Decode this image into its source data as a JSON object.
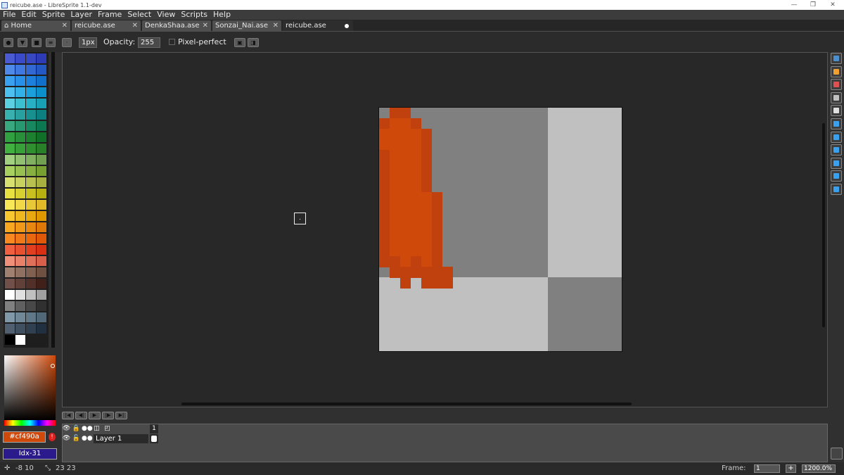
{
  "window": {
    "title": "reicube.ase - LibreSprite 1.1-dev",
    "minimize": "—",
    "maximize": "❐",
    "close": "✕"
  },
  "menu": [
    "File",
    "Edit",
    "Sprite",
    "Layer",
    "Frame",
    "Select",
    "View",
    "Scripts",
    "Help"
  ],
  "tabs": [
    {
      "label": "Home",
      "close": "✕"
    },
    {
      "label": "reicube.ase",
      "close": "✕"
    },
    {
      "label": "DenkaShaa.ase",
      "close": "✕"
    },
    {
      "label": "Sonzai_Nai.ase",
      "close": "✕"
    },
    {
      "label": "reicube.ase",
      "modified": true
    }
  ],
  "context": {
    "brush_size": "1px",
    "opacity_label": "Opacity:",
    "opacity_value": "255",
    "pixel_perfect_label": "Pixel-perfect",
    "pixel_perfect_checked": false
  },
  "palette": [
    [
      "#4a5ad0",
      "#3a4ac8",
      "#3848c0",
      "#2d3cb6"
    ],
    [
      "#4f8ae8",
      "#3e78e0",
      "#3268d2",
      "#2458c4"
    ],
    [
      "#3aa0f0",
      "#2890e8",
      "#1c80dc",
      "#1070cc"
    ],
    [
      "#4ec0f0",
      "#32b0e8",
      "#1ca0dc",
      "#0c90cc"
    ],
    [
      "#5ad0e0",
      "#3cc0d0",
      "#28b0c4",
      "#18a0b4"
    ],
    [
      "#38b0b0",
      "#28a0a0",
      "#189090",
      "#0c8080"
    ],
    [
      "#38a880",
      "#289870",
      "#188860",
      "#0c7850"
    ],
    [
      "#30a040",
      "#289038",
      "#1c8030",
      "#107028"
    ],
    [
      "#40b040",
      "#38a038",
      "#309030",
      "#288028"
    ],
    [
      "#a0d080",
      "#90c070",
      "#80b060",
      "#70a050"
    ],
    [
      "#a8d060",
      "#98c050",
      "#88b040",
      "#78a030"
    ],
    [
      "#d8e070",
      "#c8d060",
      "#b8c050",
      "#a8b040"
    ],
    [
      "#e8e040",
      "#d8d030",
      "#c8c020",
      "#b8b010"
    ],
    [
      "#f8e858",
      "#f0d848",
      "#e8c838",
      "#e0b828"
    ],
    [
      "#f8c830",
      "#f0b820",
      "#e8a810",
      "#e09800"
    ],
    [
      "#f8a820",
      "#f09818",
      "#e88810",
      "#e07808"
    ],
    [
      "#f88820",
      "#f07818",
      "#e86810",
      "#e05808"
    ],
    [
      "#f06040",
      "#e85030",
      "#e04020",
      "#d83010"
    ],
    [
      "#f0907a",
      "#e8806a",
      "#e0705a",
      "#d8604a"
    ],
    [
      "#a08070",
      "#907060",
      "#806050",
      "#705040"
    ],
    [
      "#705048",
      "#604038",
      "#503028",
      "#402018"
    ],
    [
      "#ffffff",
      "#e0e0e0",
      "#c0c0c0",
      "#a0a0a0"
    ],
    [
      "#808080",
      "#606060",
      "#484848",
      "#303030"
    ],
    [
      "#8098a8",
      "#708898",
      "#607888",
      "#506878"
    ],
    [
      "#506070",
      "#405060",
      "#304050",
      "#203040"
    ],
    [
      "#000000",
      "#ffffff",
      "#1e1e1e",
      "#1e1e1e"
    ]
  ],
  "colors": {
    "foreground": "#cf490a",
    "foreground_label": "#cf490a",
    "background_label": "Idx-31"
  },
  "canvas": {
    "grid": 23,
    "light": "#c0c0c0",
    "dark": "#808080",
    "pixels": [
      [
        0,
        1,
        "#c0400e"
      ],
      [
        0,
        2,
        "#c0400e"
      ],
      [
        1,
        0,
        "#c0400e"
      ],
      [
        1,
        1,
        "#cf490a"
      ],
      [
        1,
        2,
        "#cf490a"
      ],
      [
        1,
        3,
        "#c0400e"
      ],
      [
        2,
        0,
        "#cf490a"
      ],
      [
        2,
        1,
        "#cf490a"
      ],
      [
        2,
        2,
        "#cf490a"
      ],
      [
        2,
        3,
        "#cf490a"
      ],
      [
        2,
        4,
        "#c0400e"
      ],
      [
        3,
        0,
        "#cf490a"
      ],
      [
        3,
        1,
        "#cf490a"
      ],
      [
        3,
        2,
        "#cf490a"
      ],
      [
        3,
        3,
        "#cf490a"
      ],
      [
        3,
        4,
        "#c0400e"
      ],
      [
        4,
        0,
        "#c0400e"
      ],
      [
        4,
        1,
        "#cf490a"
      ],
      [
        4,
        2,
        "#cf490a"
      ],
      [
        4,
        3,
        "#cf490a"
      ],
      [
        4,
        4,
        "#c0400e"
      ],
      [
        5,
        0,
        "#c0400e"
      ],
      [
        5,
        1,
        "#cf490a"
      ],
      [
        5,
        2,
        "#cf490a"
      ],
      [
        5,
        3,
        "#cf490a"
      ],
      [
        5,
        4,
        "#c0400e"
      ],
      [
        6,
        0,
        "#c0400e"
      ],
      [
        6,
        1,
        "#cf490a"
      ],
      [
        6,
        2,
        "#cf490a"
      ],
      [
        6,
        3,
        "#cf490a"
      ],
      [
        6,
        4,
        "#c0400e"
      ],
      [
        7,
        0,
        "#c0400e"
      ],
      [
        7,
        1,
        "#cf490a"
      ],
      [
        7,
        2,
        "#cf490a"
      ],
      [
        7,
        3,
        "#cf490a"
      ],
      [
        7,
        4,
        "#c0400e"
      ],
      [
        8,
        0,
        "#c0400e"
      ],
      [
        8,
        1,
        "#cf490a"
      ],
      [
        8,
        2,
        "#cf490a"
      ],
      [
        8,
        3,
        "#cf490a"
      ],
      [
        8,
        4,
        "#cf490a"
      ],
      [
        8,
        5,
        "#c0400e"
      ],
      [
        9,
        0,
        "#c0400e"
      ],
      [
        9,
        1,
        "#cf490a"
      ],
      [
        9,
        2,
        "#cf490a"
      ],
      [
        9,
        3,
        "#cf490a"
      ],
      [
        9,
        4,
        "#cf490a"
      ],
      [
        9,
        5,
        "#c0400e"
      ],
      [
        10,
        0,
        "#c0400e"
      ],
      [
        10,
        1,
        "#cf490a"
      ],
      [
        10,
        2,
        "#cf490a"
      ],
      [
        10,
        3,
        "#cf490a"
      ],
      [
        10,
        4,
        "#cf490a"
      ],
      [
        10,
        5,
        "#c0400e"
      ],
      [
        11,
        0,
        "#c0400e"
      ],
      [
        11,
        1,
        "#cf490a"
      ],
      [
        11,
        2,
        "#cf490a"
      ],
      [
        11,
        3,
        "#cf490a"
      ],
      [
        11,
        4,
        "#cf490a"
      ],
      [
        11,
        5,
        "#c0400e"
      ],
      [
        12,
        0,
        "#c0400e"
      ],
      [
        12,
        1,
        "#cf490a"
      ],
      [
        12,
        2,
        "#cf490a"
      ],
      [
        12,
        3,
        "#cf490a"
      ],
      [
        12,
        4,
        "#cf490a"
      ],
      [
        12,
        5,
        "#c0400e"
      ],
      [
        13,
        0,
        "#c0400e"
      ],
      [
        13,
        1,
        "#cf490a"
      ],
      [
        13,
        2,
        "#cf490a"
      ],
      [
        13,
        3,
        "#cf490a"
      ],
      [
        13,
        4,
        "#cf490a"
      ],
      [
        13,
        5,
        "#c0400e"
      ],
      [
        14,
        0,
        "#c0400e"
      ],
      [
        14,
        1,
        "#c0400e"
      ],
      [
        14,
        2,
        "#cf490a"
      ],
      [
        14,
        3,
        "#c0400e"
      ],
      [
        14,
        4,
        "#cf490a"
      ],
      [
        14,
        5,
        "#c0400e"
      ],
      [
        15,
        1,
        "#c0400e"
      ],
      [
        15,
        2,
        "#c0400e"
      ],
      [
        15,
        3,
        "#c0400e"
      ],
      [
        15,
        4,
        "#c0400e"
      ],
      [
        15,
        5,
        "#c0400e"
      ],
      [
        15,
        6,
        "#c0400e"
      ],
      [
        16,
        2,
        "#c0400e"
      ],
      [
        16,
        4,
        "#c0400e"
      ],
      [
        16,
        5,
        "#c0400e"
      ],
      [
        16,
        6,
        "#c0400e"
      ]
    ]
  },
  "tools": [
    {
      "name": "marquee-tool-icon",
      "color": "#4a90d0"
    },
    {
      "name": "pencil-tool-icon",
      "color": "#f0a030"
    },
    {
      "name": "eraser-tool-icon",
      "color": "#e05050"
    },
    {
      "name": "eyedropper-tool-icon",
      "color": "#c0c0c0"
    },
    {
      "name": "zoom-tool-icon",
      "color": "#e0e0e0"
    },
    {
      "name": "move-tool-icon",
      "color": "#3aa0f0"
    },
    {
      "name": "paint-bucket-tool-icon",
      "color": "#3aa0f0"
    },
    {
      "name": "line-tool-icon",
      "color": "#3aa0f0"
    },
    {
      "name": "rectangle-tool-icon",
      "color": "#3aa0f0"
    },
    {
      "name": "lasso-tool-icon",
      "color": "#3aa0f0"
    },
    {
      "name": "blur-tool-icon",
      "color": "#3aa0f0"
    }
  ],
  "timeline": {
    "frame_header": "1",
    "layer_name": "Layer 1"
  },
  "status": {
    "cursor_pos": "-8 10",
    "sprite_size": "23 23",
    "frame_label": "Frame:",
    "frame_value": "1",
    "plus": "+",
    "zoom": "1200.0%"
  }
}
